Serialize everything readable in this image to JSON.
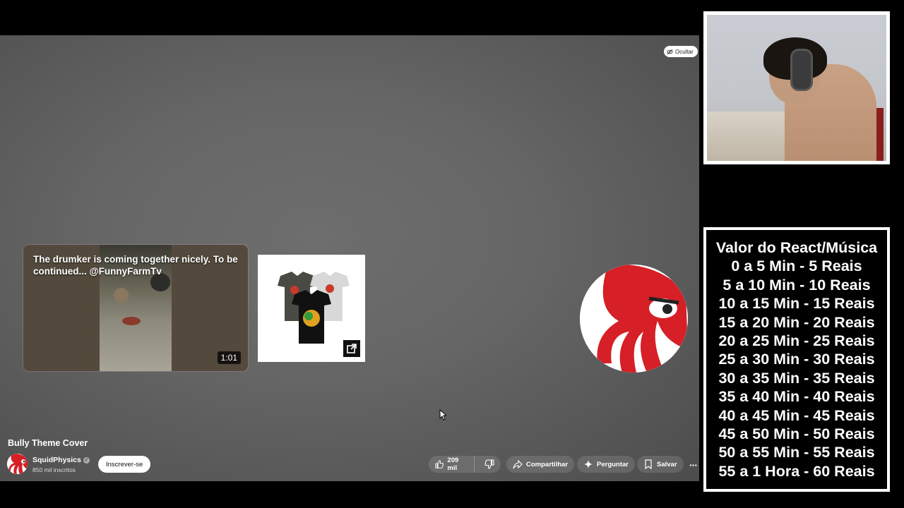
{
  "player": {
    "hide_label": "Ocultar",
    "card_video": {
      "title": "The drumker is coming together nicely. To be continued... @FunnyFarmTv",
      "duration": "1:01"
    }
  },
  "video": {
    "title": "Bully Theme Cover",
    "channel_name": "SquidPhysics",
    "subscribers": "850 mil inscritos",
    "subscribe_label": "Inscrever-se",
    "likes": "209 mil",
    "share_label": "Compartilhar",
    "ask_label": "Perguntar",
    "save_label": "Salvar",
    "more_label": "···"
  },
  "overlay": {
    "price_title": "Valor do React/Música",
    "prices": [
      "0 a 5 Min - 5 Reais",
      "5 a 10 Min - 10 Reais",
      "10 a 15 Min - 15 Reais",
      "15 a 20 Min - 20 Reais",
      "20 a 25 Min - 25 Reais",
      "25 a 30 Min - 30 Reais",
      "30 a 35 Min - 35 Reais",
      "35 a 40 Min - 40 Reais",
      "40 a 45 Min - 45 Reais",
      "45 a 50 Min - 50 Reais",
      "50 a 55 Min - 55 Reais",
      "55 a 1 Hora - 60 Reais"
    ]
  },
  "colors": {
    "brand_red": "#d61f26",
    "player_gray": "#666666"
  }
}
